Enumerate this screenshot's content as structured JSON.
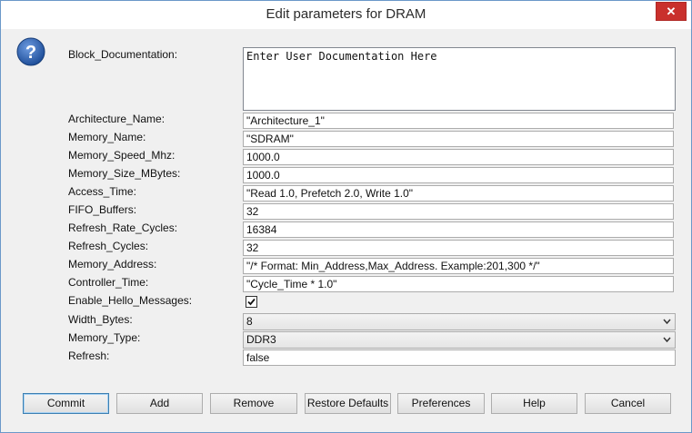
{
  "window": {
    "title": "Edit parameters for DRAM",
    "close_glyph": "✕"
  },
  "icons": {
    "help": "question-mark-icon",
    "close": "close-icon",
    "check": "checkmark-icon",
    "dropdown": "chevron-down-icon"
  },
  "fields": {
    "block_documentation": {
      "label": "Block_Documentation:",
      "value": "Enter User Documentation Here"
    },
    "architecture_name": {
      "label": "Architecture_Name:",
      "value": "\"Architecture_1\""
    },
    "memory_name": {
      "label": "Memory_Name:",
      "value": "\"SDRAM\""
    },
    "memory_speed_mhz": {
      "label": "Memory_Speed_Mhz:",
      "value": "1000.0"
    },
    "memory_size_mbytes": {
      "label": "Memory_Size_MBytes:",
      "value": "1000.0"
    },
    "access_time": {
      "label": "Access_Time:",
      "value": "\"Read 1.0, Prefetch 2.0, Write 1.0\""
    },
    "fifo_buffers": {
      "label": "FIFO_Buffers:",
      "value": "32"
    },
    "refresh_rate_cycles": {
      "label": "Refresh_Rate_Cycles:",
      "value": "16384"
    },
    "refresh_cycles": {
      "label": "Refresh_Cycles:",
      "value": "32"
    },
    "memory_address": {
      "label": "Memory_Address:",
      "value": "\"/* Format: Min_Address,Max_Address. Example:201,300 */\""
    },
    "controller_time": {
      "label": "Controller_Time:",
      "value": "\"Cycle_Time * 1.0\""
    },
    "enable_hello_messages": {
      "label": "Enable_Hello_Messages:",
      "checked": true
    },
    "width_bytes": {
      "label": "Width_Bytes:",
      "value": "8"
    },
    "memory_type": {
      "label": "Memory_Type:",
      "value": "DDR3"
    },
    "refresh": {
      "label": "Refresh:",
      "value": "false"
    }
  },
  "buttons": {
    "commit": "Commit",
    "add": "Add",
    "remove": "Remove",
    "restore_defaults": "Restore Defaults",
    "preferences": "Preferences",
    "help": "Help",
    "cancel": "Cancel"
  },
  "colors": {
    "accent": "#3c7fb1",
    "close": "#c9302c",
    "help_icon": "#2a5ca8"
  }
}
